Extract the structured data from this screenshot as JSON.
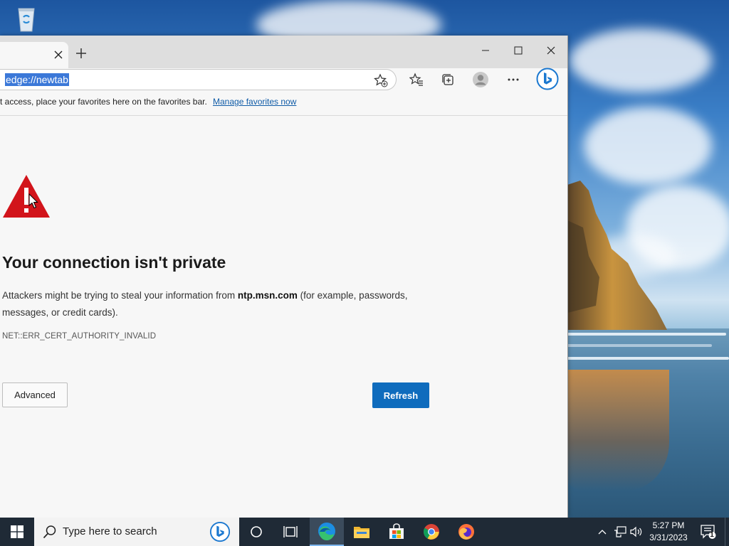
{
  "browser": {
    "address_value": "edge://newtab",
    "favorites_bar": {
      "message": "t access, place your favorites here on the favorites bar.",
      "link": "Manage favorites now"
    }
  },
  "error_page": {
    "title": "Your connection isn't private",
    "description_before": "Attackers might be trying to steal your information from ",
    "domain": "ntp.msn.com",
    "description_after": " (for example, passwords, messages, or credit cards).",
    "error_code": "NET::ERR_CERT_AUTHORITY_INVALID",
    "advanced_label": "Advanced",
    "refresh_label": "Refresh"
  },
  "taskbar": {
    "search_placeholder": "Type here to search",
    "time": "5:27 PM",
    "date": "3/31/2023",
    "notification_count": "1",
    "pinned_apps": [
      "task-view",
      "edge",
      "file-explorer",
      "microsoft-store",
      "chrome",
      "firefox"
    ]
  },
  "colors": {
    "accent_blue": "#0f6cbd",
    "warning_red": "#d2141b",
    "address_selection": "#3b78d8",
    "taskbar_bg": "#1f2a36"
  }
}
